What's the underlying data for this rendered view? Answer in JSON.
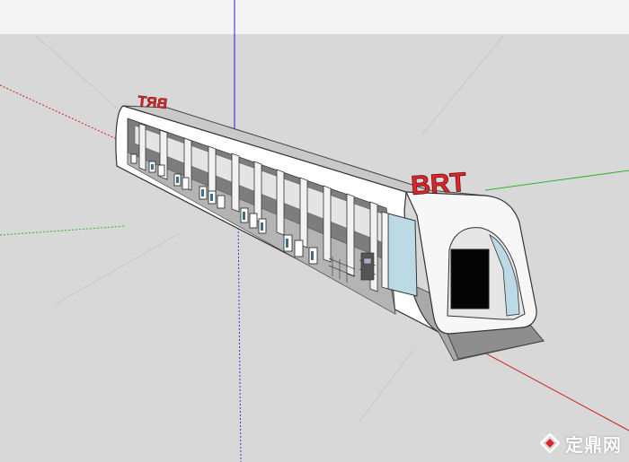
{
  "signs": {
    "front": "BRT",
    "rear_mirrored": "BRT"
  },
  "watermark": {
    "text": "定鼎网",
    "icon": "diamond-logo-icon"
  },
  "colors": {
    "sign_red": "#d8262b",
    "red_axis": "#d02020",
    "green_axis": "#30b030",
    "blue_axis": "#2020d0",
    "glass": "#bcd9e6",
    "roof": "#c9c9c9"
  }
}
